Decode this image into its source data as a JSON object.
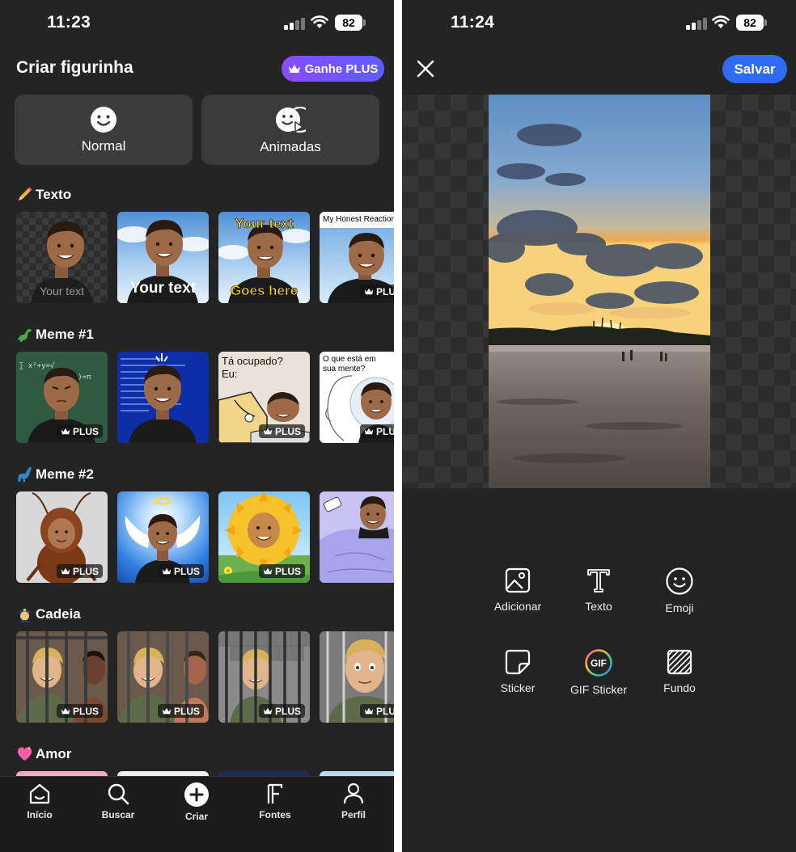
{
  "left": {
    "status": {
      "time": "11:23",
      "battery": "82"
    },
    "title": "Criar figurinha",
    "plus_button": "Ganhe PLUS",
    "modes": [
      {
        "label": "Normal",
        "icon": "smiley-icon"
      },
      {
        "label": "Animadas",
        "icon": "animated-smiley-icon"
      }
    ],
    "sections": [
      {
        "emoji": "pencil-emoji",
        "title": "Texto",
        "items": [
          {
            "caption": "Your text"
          },
          {
            "caption": "Your text"
          },
          {
            "caption_top": "Your text",
            "caption_bottom": "Goes here"
          },
          {
            "note": "My Honest Reaction",
            "badge": "PLUS"
          }
        ]
      },
      {
        "emoji": "dinosaur-emoji",
        "title": "Meme #1",
        "items": [
          {
            "badge": "PLUS"
          },
          {},
          {
            "note": "Tá ocupado?\nEu:",
            "badge": "PLUS"
          },
          {
            "note": "O que está em sua mente?",
            "badge": "PLUS"
          }
        ]
      },
      {
        "emoji": "sauropod-emoji",
        "title": "Meme #2",
        "items": [
          {
            "badge": "PLUS"
          },
          {
            "badge": "PLUS"
          },
          {
            "badge": "PLUS"
          },
          {}
        ]
      },
      {
        "emoji": "police-officer-emoji",
        "title": "Cadeia",
        "items": [
          {
            "badge": "PLUS"
          },
          {
            "badge": "PLUS"
          },
          {
            "badge": "PLUS"
          },
          {
            "badge": "PLUS"
          }
        ]
      },
      {
        "emoji": "sparkling-heart-emoji",
        "title": "Amor"
      }
    ],
    "tabs": [
      {
        "label": "Início",
        "icon": "home-icon"
      },
      {
        "label": "Buscar",
        "icon": "search-icon"
      },
      {
        "label": "Criar",
        "icon": "plus-circle-icon"
      },
      {
        "label": "Fontes",
        "icon": "font-icon"
      },
      {
        "label": "Perfil",
        "icon": "profile-icon"
      }
    ]
  },
  "right": {
    "status": {
      "time": "11:24",
      "battery": "82"
    },
    "save_button": "Salvar",
    "tools": [
      {
        "label": "Adicionar",
        "icon": "image-icon"
      },
      {
        "label": "Texto",
        "icon": "text-icon"
      },
      {
        "label": "Emoji",
        "icon": "emoji-icon"
      },
      {
        "label": "Sticker",
        "icon": "sticker-icon"
      },
      {
        "label": "GIF Sticker",
        "icon": "gif-icon",
        "icon_text": "GIF"
      },
      {
        "label": "Fundo",
        "icon": "background-icon"
      }
    ]
  },
  "colors": {
    "background": "#242424",
    "plus_gradient_start": "#8a4dff",
    "plus_gradient_end": "#5b5cff",
    "save": "#2f6bf2"
  }
}
